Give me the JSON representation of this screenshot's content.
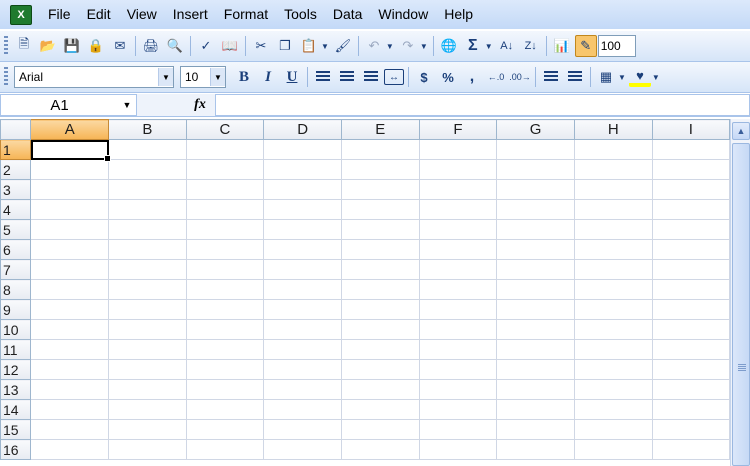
{
  "menu": {
    "items": [
      "File",
      "Edit",
      "View",
      "Insert",
      "Format",
      "Tools",
      "Data",
      "Window",
      "Help"
    ]
  },
  "app_icon": "excel-icon",
  "standard_toolbar": {
    "zoom": "100"
  },
  "formatting_toolbar": {
    "font_name": "Arial",
    "font_size": "10",
    "bold": "B",
    "italic": "I",
    "underline": "U",
    "currency": "$",
    "percent": "%",
    "comma": ","
  },
  "formula_bar": {
    "name_box": "A1",
    "fx_label": "fx",
    "formula": ""
  },
  "sheet": {
    "columns": [
      "A",
      "B",
      "C",
      "D",
      "E",
      "F",
      "G",
      "H",
      "I"
    ],
    "rows": [
      "1",
      "2",
      "3",
      "4",
      "5",
      "6",
      "7",
      "8",
      "9",
      "10",
      "11",
      "12",
      "13",
      "14",
      "15",
      "16"
    ],
    "selected_cell": "A1"
  },
  "colors": {
    "menubar": "#c3d9f7",
    "selected_header": "#f6b455",
    "gridline": "#d0d7e5"
  }
}
